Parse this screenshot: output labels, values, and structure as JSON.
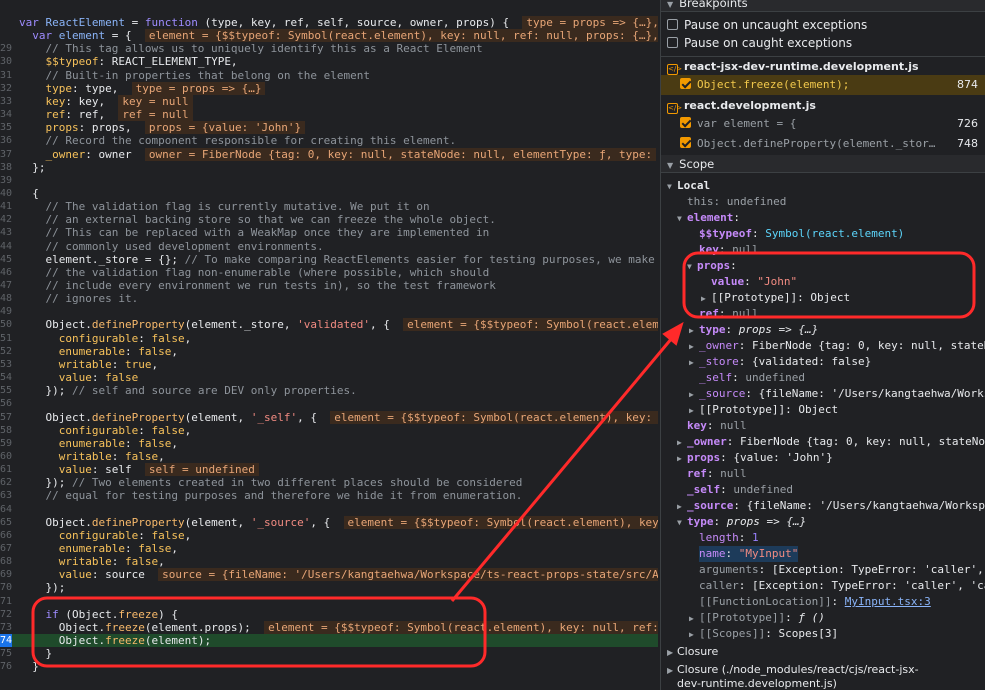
{
  "editor": {
    "lines": [
      {
        "gutter": "",
        "html": [
          [
            "kb",
            "var "
          ],
          [
            "p",
            "ReactElement"
          ],
          [
            "o",
            " = "
          ],
          [
            "kb",
            "function"
          ],
          [
            "o",
            " (type, key, ref, self, source, owner, props) {  "
          ],
          [
            "inl",
            "type = props => {…}, "
          ]
        ]
      },
      {
        "gutter": "",
        "html": [
          [
            "o",
            "  "
          ],
          [
            "kb",
            "var "
          ],
          [
            "p",
            "element"
          ],
          [
            "o",
            " = {  "
          ],
          [
            "inl",
            "element = {$$typeof: Symbol(react.element), key: null, ref: null, props: {…},"
          ]
        ]
      },
      {
        "gutter": "29",
        "html": [
          [
            "c",
            "    // This tag allows us to uniquely identify this as a React Element"
          ]
        ]
      },
      {
        "gutter": "30",
        "html": [
          [
            "o",
            "    "
          ],
          [
            "pr",
            "$$typeof"
          ],
          [
            "o",
            ": REACT_ELEMENT_TYPE,"
          ]
        ]
      },
      {
        "gutter": "31",
        "html": [
          [
            "c",
            "    // Built-in properties that belong on the element"
          ]
        ]
      },
      {
        "gutter": "32",
        "html": [
          [
            "o",
            "    "
          ],
          [
            "pr",
            "type"
          ],
          [
            "o",
            ": type,  "
          ],
          [
            "inl",
            "type = props => {…}"
          ]
        ]
      },
      {
        "gutter": "33",
        "html": [
          [
            "o",
            "    "
          ],
          [
            "pr",
            "key"
          ],
          [
            "o",
            ": key,  "
          ],
          [
            "inl",
            "key = null"
          ]
        ]
      },
      {
        "gutter": "34",
        "html": [
          [
            "o",
            "    "
          ],
          [
            "pr",
            "ref"
          ],
          [
            "o",
            ": ref,  "
          ],
          [
            "inl",
            "ref = null"
          ]
        ]
      },
      {
        "gutter": "35",
        "html": [
          [
            "o",
            "    "
          ],
          [
            "pr",
            "props"
          ],
          [
            "o",
            ": props,  "
          ],
          [
            "inl",
            "props = {value: 'John'}"
          ]
        ]
      },
      {
        "gutter": "36",
        "html": [
          [
            "c",
            "    // Record the component responsible for creating this element."
          ]
        ]
      },
      {
        "gutter": "37",
        "html": [
          [
            "o",
            "    "
          ],
          [
            "pr",
            "_owner"
          ],
          [
            "o",
            ": owner  "
          ],
          [
            "inl",
            "owner = FiberNode {tag: 0, key: null, stateNode: null, elementType: ƒ, type:"
          ]
        ]
      },
      {
        "gutter": "38",
        "html": [
          [
            "o",
            "  };"
          ]
        ]
      },
      {
        "gutter": "39",
        "html": [
          [
            "o",
            ""
          ]
        ]
      },
      {
        "gutter": "40",
        "html": [
          [
            "o",
            "  {"
          ]
        ]
      },
      {
        "gutter": "41",
        "html": [
          [
            "c",
            "    // The validation flag is currently mutative. We put it on"
          ]
        ]
      },
      {
        "gutter": "42",
        "html": [
          [
            "c",
            "    // an external backing store so that we can freeze the whole object."
          ]
        ]
      },
      {
        "gutter": "43",
        "html": [
          [
            "c",
            "    // This can be replaced with a WeakMap once they are implemented in"
          ]
        ]
      },
      {
        "gutter": "44",
        "html": [
          [
            "c",
            "    // commonly used development environments."
          ]
        ]
      },
      {
        "gutter": "45",
        "html": [
          [
            "o",
            "    element._store = {}; "
          ],
          [
            "c",
            "// To make comparing ReactElements easier for testing purposes, we make"
          ]
        ]
      },
      {
        "gutter": "46",
        "html": [
          [
            "c",
            "    // the validation flag non-enumerable (where possible, which should"
          ]
        ]
      },
      {
        "gutter": "47",
        "html": [
          [
            "c",
            "    // include every environment we run tests in), so the test framework"
          ]
        ]
      },
      {
        "gutter": "48",
        "html": [
          [
            "c",
            "    // ignores it."
          ]
        ]
      },
      {
        "gutter": "49",
        "html": [
          [
            "o",
            ""
          ]
        ]
      },
      {
        "gutter": "50",
        "html": [
          [
            "o",
            "    Object."
          ],
          [
            "f",
            "defineProperty"
          ],
          [
            "o",
            "(element._store, "
          ],
          [
            "s",
            "'validated'"
          ],
          [
            "o",
            ", {  "
          ],
          [
            "inl",
            "element = {$$typeof: Symbol(react.eleme"
          ]
        ]
      },
      {
        "gutter": "51",
        "html": [
          [
            "o",
            "      "
          ],
          [
            "pr",
            "configurable"
          ],
          [
            "o",
            ": "
          ],
          [
            "pr",
            "false"
          ],
          [
            "o",
            ","
          ]
        ]
      },
      {
        "gutter": "52",
        "html": [
          [
            "o",
            "      "
          ],
          [
            "pr",
            "enumerable"
          ],
          [
            "o",
            ": "
          ],
          [
            "pr",
            "false"
          ],
          [
            "o",
            ","
          ]
        ]
      },
      {
        "gutter": "53",
        "html": [
          [
            "o",
            "      "
          ],
          [
            "pr",
            "writable"
          ],
          [
            "o",
            ": "
          ],
          [
            "pr",
            "true"
          ],
          [
            "o",
            ","
          ]
        ]
      },
      {
        "gutter": "54",
        "html": [
          [
            "o",
            "      "
          ],
          [
            "pr",
            "value"
          ],
          [
            "o",
            ": "
          ],
          [
            "pr",
            "false"
          ]
        ]
      },
      {
        "gutter": "55",
        "html": [
          [
            "o",
            "    }); "
          ],
          [
            "c",
            "// self and source are DEV only properties."
          ]
        ]
      },
      {
        "gutter": "56",
        "html": [
          [
            "o",
            ""
          ]
        ]
      },
      {
        "gutter": "57",
        "html": [
          [
            "o",
            "    Object."
          ],
          [
            "f",
            "defineProperty"
          ],
          [
            "o",
            "(element, "
          ],
          [
            "s",
            "'_self'"
          ],
          [
            "o",
            ", {  "
          ],
          [
            "inl",
            "element = {$$typeof: Symbol(react.element), key: n"
          ]
        ]
      },
      {
        "gutter": "58",
        "html": [
          [
            "o",
            "      "
          ],
          [
            "pr",
            "configurable"
          ],
          [
            "o",
            ": "
          ],
          [
            "pr",
            "false"
          ],
          [
            "o",
            ","
          ]
        ]
      },
      {
        "gutter": "59",
        "html": [
          [
            "o",
            "      "
          ],
          [
            "pr",
            "enumerable"
          ],
          [
            "o",
            ": "
          ],
          [
            "pr",
            "false"
          ],
          [
            "o",
            ","
          ]
        ]
      },
      {
        "gutter": "60",
        "html": [
          [
            "o",
            "      "
          ],
          [
            "pr",
            "writable"
          ],
          [
            "o",
            ": "
          ],
          [
            "pr",
            "false"
          ],
          [
            "o",
            ","
          ]
        ]
      },
      {
        "gutter": "61",
        "html": [
          [
            "o",
            "      "
          ],
          [
            "pr",
            "value"
          ],
          [
            "o",
            ": self  "
          ],
          [
            "inl",
            "self = undefined"
          ]
        ]
      },
      {
        "gutter": "62",
        "html": [
          [
            "o",
            "    }); "
          ],
          [
            "c",
            "// Two elements created in two different places should be considered"
          ]
        ]
      },
      {
        "gutter": "63",
        "html": [
          [
            "c",
            "    // equal for testing purposes and therefore we hide it from enumeration."
          ]
        ]
      },
      {
        "gutter": "64",
        "html": [
          [
            "o",
            ""
          ]
        ]
      },
      {
        "gutter": "65",
        "html": [
          [
            "o",
            "    Object."
          ],
          [
            "f",
            "defineProperty"
          ],
          [
            "o",
            "(element, "
          ],
          [
            "s",
            "'_source'"
          ],
          [
            "o",
            ", {  "
          ],
          [
            "inl",
            "element = {$$typeof: Symbol(react.element), key"
          ]
        ]
      },
      {
        "gutter": "66",
        "html": [
          [
            "o",
            "      "
          ],
          [
            "pr",
            "configurable"
          ],
          [
            "o",
            ": "
          ],
          [
            "pr",
            "false"
          ],
          [
            "o",
            ","
          ]
        ]
      },
      {
        "gutter": "67",
        "html": [
          [
            "o",
            "      "
          ],
          [
            "pr",
            "enumerable"
          ],
          [
            "o",
            ": "
          ],
          [
            "pr",
            "false"
          ],
          [
            "o",
            ","
          ]
        ]
      },
      {
        "gutter": "68",
        "html": [
          [
            "o",
            "      "
          ],
          [
            "pr",
            "writable"
          ],
          [
            "o",
            ": "
          ],
          [
            "pr",
            "false"
          ],
          [
            "o",
            ","
          ]
        ]
      },
      {
        "gutter": "69",
        "html": [
          [
            "o",
            "      "
          ],
          [
            "pr",
            "value"
          ],
          [
            "o",
            ": source  "
          ],
          [
            "inl",
            "source = {fileName: '/Users/kangtaehwa/Workspace/ts-react-props-state/src/Ap"
          ]
        ]
      },
      {
        "gutter": "70",
        "html": [
          [
            "o",
            "    });"
          ]
        ]
      },
      {
        "gutter": "71",
        "html": [
          [
            "o",
            ""
          ]
        ]
      },
      {
        "gutter": "72",
        "html": [
          [
            "o",
            "    "
          ],
          [
            "kb",
            "if"
          ],
          [
            "o",
            " (Object."
          ],
          [
            "f",
            "freeze"
          ],
          [
            "o",
            ") {"
          ]
        ]
      },
      {
        "gutter": "73",
        "html": [
          [
            "o",
            "      Object."
          ],
          [
            "f",
            "freeze"
          ],
          [
            "o",
            "(element.props);  "
          ],
          [
            "inl",
            "element = {$$typeof: Symbol(react.element), key: null, ref:"
          ]
        ]
      },
      {
        "gutter": "74",
        "exec": true,
        "html": [
          [
            "o",
            "      Object."
          ],
          [
            "f",
            "freeze"
          ],
          [
            "o",
            "(element);"
          ]
        ]
      },
      {
        "gutter": "75",
        "html": [
          [
            "o",
            "    }"
          ]
        ]
      },
      {
        "gutter": "76",
        "html": [
          [
            "o",
            "  }"
          ]
        ]
      }
    ]
  },
  "breakpoints": {
    "header": "Breakpoints",
    "pause_uncaught": "Pause on uncaught exceptions",
    "pause_caught": "Pause on caught exceptions",
    "files": [
      {
        "name": "react-jsx-dev-runtime.development.js",
        "items": [
          {
            "text": "Object.freeze(element);",
            "line": "874",
            "active": true
          }
        ]
      },
      {
        "name": "react.development.js",
        "items": [
          {
            "text": "var element = {",
            "line": "726",
            "active": false
          },
          {
            "text": "Object.defineProperty(element._store…",
            "line": "748",
            "active": false
          }
        ]
      }
    ]
  },
  "scope": {
    "header": "Scope",
    "local": "Local",
    "this_key": "this",
    "this_val": "undefined",
    "element_key": "element",
    "typeof_key": "$$typeof",
    "typeof_val": "Symbol(react.element)",
    "key_key": "key",
    "key_val": "null",
    "props_key": "props",
    "props_value_key": "value",
    "props_value_val": "\"John\"",
    "proto_key": "[[Prototype]]",
    "proto_val": "Object",
    "ref_key": "ref",
    "ref_val": "null",
    "type_key": "type",
    "type_val": "props => {…}",
    "owner_key": "_owner",
    "owner_val": "FiberNode {tag: 0, key: null, stateN",
    "store_key": "_store",
    "store_val": "{validated: false}",
    "self_key": "_self",
    "self_val": "undefined",
    "source_key": "_source",
    "source_val": "{fileName: '/Users/kangtaehwa/Works",
    "proto2_val": "Object",
    "key2_val": "null",
    "owner2_val": "FiberNode {tag: 0, key: null, stateNode",
    "props2_val": "{value: 'John'}",
    "ref2_val": "null",
    "self2_val": "undefined",
    "source2_val": "{fileName: '/Users/kangtaehwa/Workspa",
    "type2_val": "props => {…}",
    "length_key": "length",
    "length_val": "1",
    "name_key": "name",
    "name_val": "\"MyInput\"",
    "arguments_key": "arguments",
    "arguments_val": "[Exception: TypeError: 'caller', ",
    "caller_key": "caller",
    "caller_val": "[Exception: TypeError: 'caller', 'ca",
    "fnloc_key": "[[FunctionLocation]]",
    "fnloc_val": "MyInput.tsx:3",
    "proto3_val": "ƒ ()",
    "scopes_key": "[[Scopes]]",
    "scopes_val": "Scopes[3]",
    "closure": "Closure",
    "closure2_a": "Closure (./node_modules/react/cjs/react-jsx-",
    "closure2_b": "dev-runtime.development.js)"
  },
  "colors": {
    "annotation": "#ff2a2a",
    "exec_line": "#1f4b2b",
    "breakpoint_active": "#4a3b13"
  }
}
